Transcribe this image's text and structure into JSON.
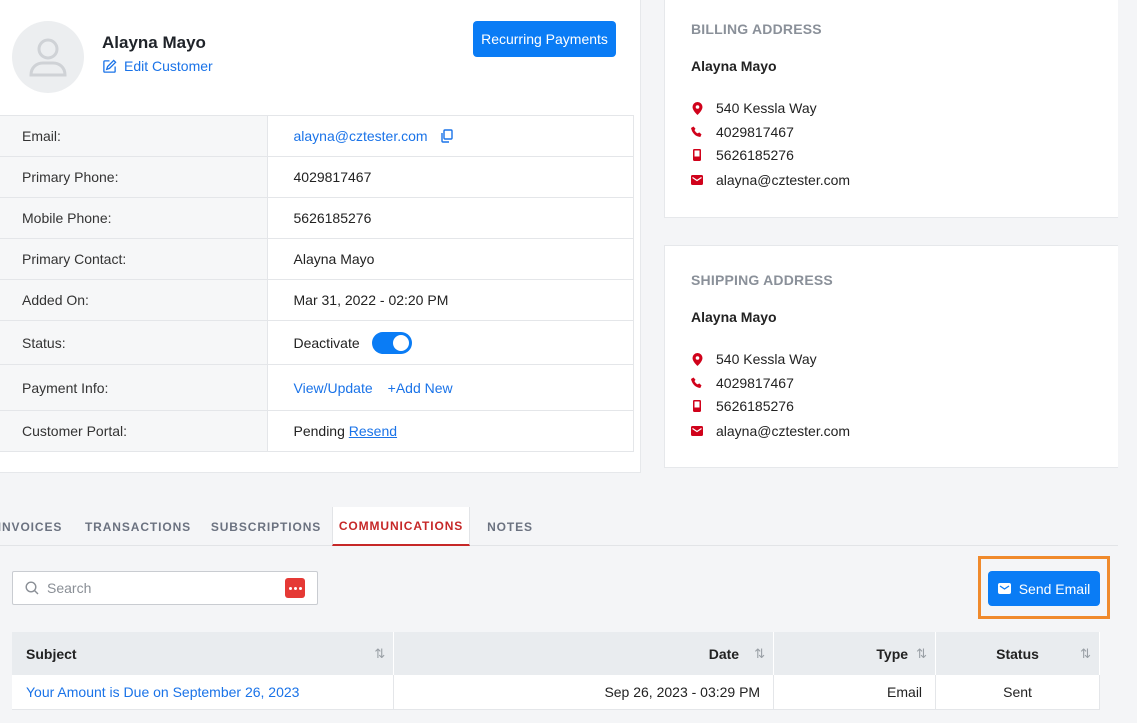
{
  "customer": {
    "name": "Alayna Mayo",
    "edit_label": "Edit Customer",
    "recurring_label": "Recurring Payments"
  },
  "info": {
    "email_label": "Email:",
    "email": "alayna@cztester.com",
    "primary_phone_label": "Primary Phone:",
    "primary_phone": "4029817467",
    "mobile_phone_label": "Mobile Phone:",
    "mobile_phone": "5626185276",
    "primary_contact_label": "Primary Contact:",
    "primary_contact": "Alayna Mayo",
    "added_on_label": "Added On:",
    "added_on": "Mar 31, 2022 - 02:20 PM",
    "status_label": "Status:",
    "status_action": "Deactivate",
    "payment_label": "Payment Info:",
    "payment_view": "View/Update",
    "payment_add": "+Add New",
    "portal_label": "Customer Portal:",
    "portal_status": "Pending",
    "portal_resend": "Resend"
  },
  "billing": {
    "title": "BILLING ADDRESS",
    "name": "Alayna Mayo",
    "address": "540 Kessla Way",
    "phone": "4029817467",
    "mobile": "5626185276",
    "email": "alayna@cztester.com"
  },
  "shipping": {
    "title": "SHIPPING ADDRESS",
    "name": "Alayna Mayo",
    "address": "540 Kessla Way",
    "phone": "4029817467",
    "mobile": "5626185276",
    "email": "alayna@cztester.com"
  },
  "tabs": [
    "INVOICES",
    "TRANSACTIONS",
    "SUBSCRIPTIONS",
    "COMMUNICATIONS",
    "NOTES"
  ],
  "active_tab": "COMMUNICATIONS",
  "search": {
    "placeholder": "Search"
  },
  "send_email_label": "Send Email",
  "comm_table": {
    "headers": [
      "Subject",
      "Date",
      "Type",
      "Status"
    ],
    "rows": [
      {
        "subject": "Your Amount is Due on September 26, 2023",
        "date": "Sep 26, 2023 - 03:29 PM",
        "type": "Email",
        "status": "Sent"
      }
    ]
  },
  "colors": {
    "primary": "#0a7cf5",
    "active_tab": "#c62828",
    "highlight": "#f08a2c",
    "icon_red": "#d0021b"
  }
}
